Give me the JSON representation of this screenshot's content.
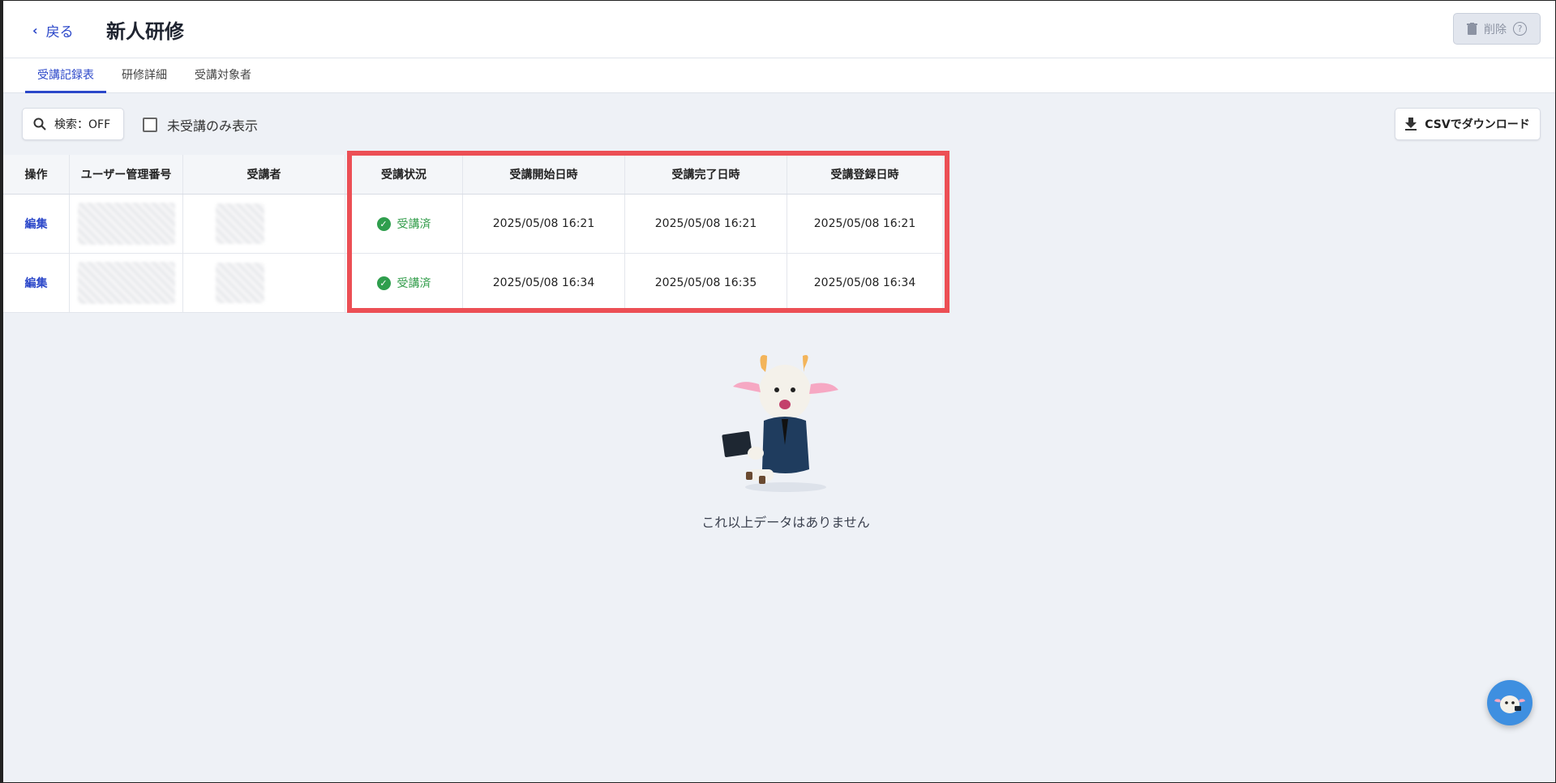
{
  "header": {
    "back_label": "戻る",
    "title": "新人研修",
    "delete_label": "削除"
  },
  "tabs": [
    {
      "label": "受講記録表",
      "active": true
    },
    {
      "label": "研修詳細",
      "active": false
    },
    {
      "label": "受講対象者",
      "active": false
    }
  ],
  "toolbar": {
    "search_label": "検索：OFF",
    "unattended_only_label": "未受講のみ表示",
    "unattended_only_checked": false,
    "csv_label": "CSVでダウンロード"
  },
  "table": {
    "columns": [
      "操作",
      "ユーザー管理番号",
      "受講者",
      "受講状況",
      "受講開始日時",
      "受講完了日時",
      "受講登録日時"
    ],
    "rows": [
      {
        "action": "編集",
        "status": "受講済",
        "start": "2025/05/08 16:21",
        "end": "2025/05/08 16:21",
        "registered": "2025/05/08 16:21"
      },
      {
        "action": "編集",
        "status": "受講済",
        "start": "2025/05/08 16:34",
        "end": "2025/05/08 16:35",
        "registered": "2025/05/08 16:34"
      }
    ]
  },
  "empty_state": {
    "message": "これ以上データはありません"
  },
  "colors": {
    "accent": "#2b47c9",
    "success": "#2e9b47",
    "highlight": "#ec4f55",
    "background": "#eef1f6"
  }
}
